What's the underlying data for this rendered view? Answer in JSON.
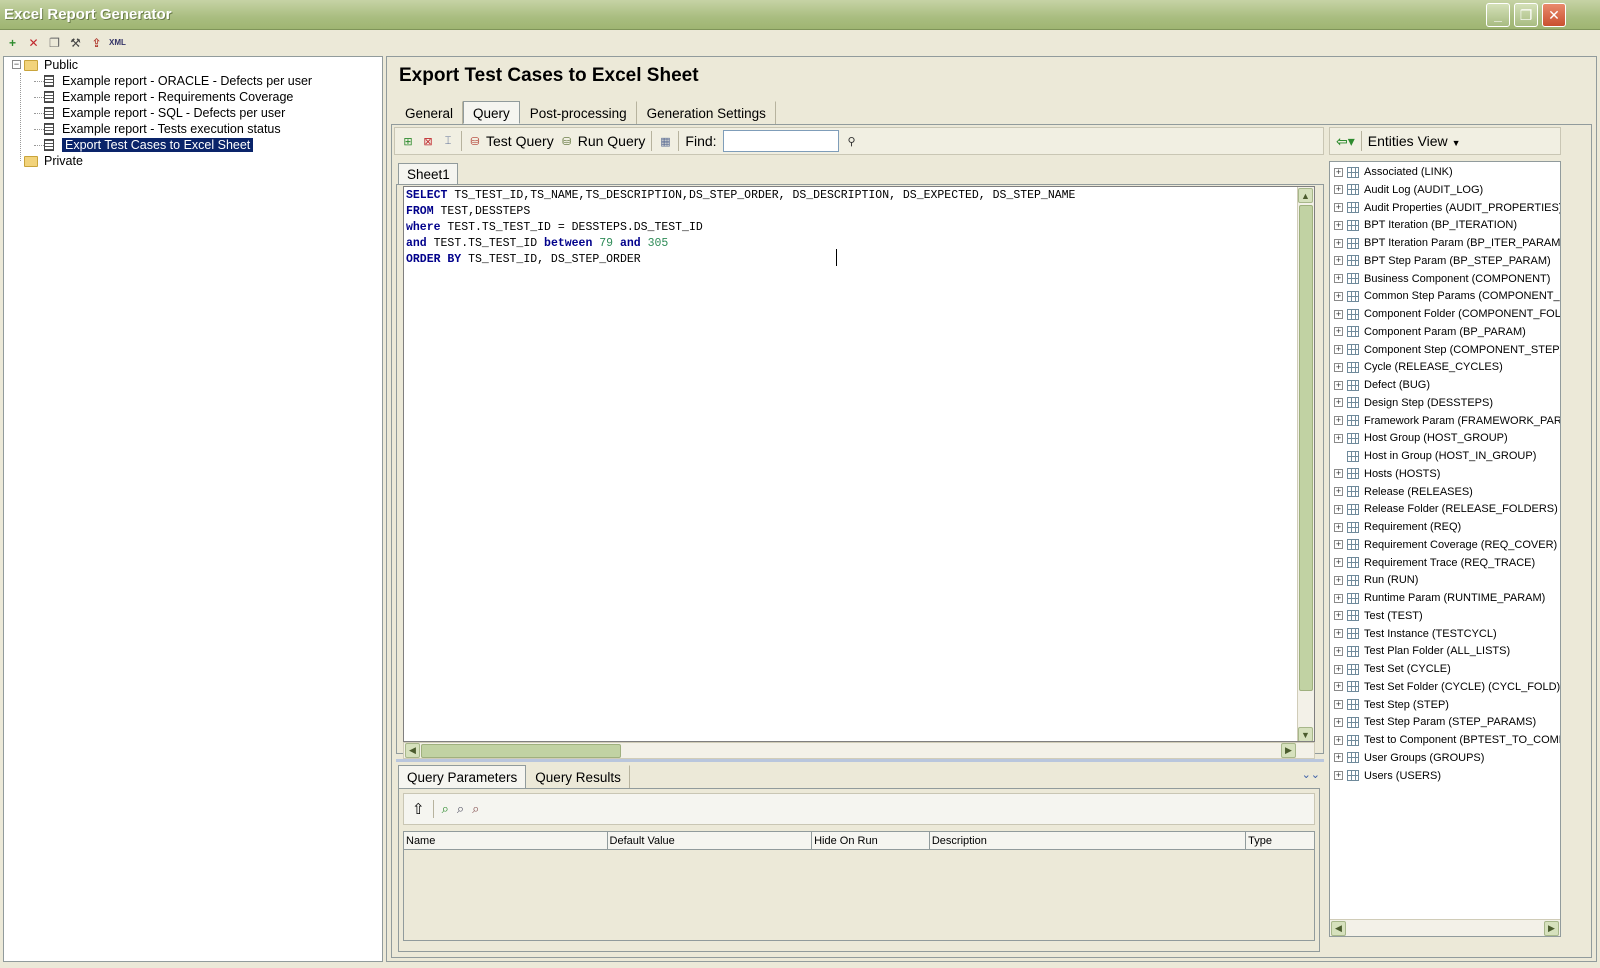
{
  "window": {
    "title": "Excel Report Generator"
  },
  "tree": {
    "public_label": "Public",
    "private_label": "Private",
    "reports": [
      "Example report - ORACLE - Defects per user",
      "Example report - Requirements Coverage",
      "Example report - SQL - Defects per user",
      "Example report - Tests execution status",
      "Export Test Cases to Excel Sheet"
    ]
  },
  "page": {
    "title": "Export Test Cases to Excel Sheet",
    "tabs": [
      "General",
      "Query",
      "Post-processing",
      "Generation Settings"
    ],
    "active_tab": "Query"
  },
  "query_toolbar": {
    "test_query": "Test Query",
    "run_query": "Run Query",
    "find_label": "Find:",
    "find_value": ""
  },
  "sheet": {
    "tab": "Sheet1"
  },
  "sql": {
    "line1_kw": "SELECT",
    "line1_rest": " TS_TEST_ID,TS_NAME,TS_DESCRIPTION,DS_STEP_ORDER, DS_DESCRIPTION, DS_EXPECTED, DS_STEP_NAME",
    "line2_kw": "FROM",
    "line2_rest": " TEST,DESSTEPS",
    "line3_kw": "where",
    "line3_rest": " TEST.TS_TEST_ID = DESSTEPS.DS_TEST_ID",
    "line4_kw1": "and",
    "line4_mid": " TEST.TS_TEST_ID ",
    "line4_kw2": "between",
    "line4_n1": "79",
    "line4_kw3": "and",
    "line4_n2": "305",
    "line5_kw": "ORDER BY",
    "line5_rest": " TS_TEST_ID, DS_STEP_ORDER"
  },
  "bottom": {
    "tabs": [
      "Query Parameters",
      "Query Results"
    ],
    "columns": [
      "Name",
      "Default Value",
      "Hide On Run",
      "Description",
      "Type"
    ]
  },
  "entities": {
    "view_label": "Entities View",
    "items": [
      {
        "label": "Associated (LINK)",
        "expandable": true
      },
      {
        "label": "Audit Log (AUDIT_LOG)",
        "expandable": true
      },
      {
        "label": "Audit Properties (AUDIT_PROPERTIES)",
        "expandable": true
      },
      {
        "label": "BPT Iteration (BP_ITERATION)",
        "expandable": true
      },
      {
        "label": "BPT Iteration Param (BP_ITER_PARAM)",
        "expandable": true
      },
      {
        "label": "BPT Step Param (BP_STEP_PARAM)",
        "expandable": true
      },
      {
        "label": "Business Component (COMPONENT)",
        "expandable": true
      },
      {
        "label": "Common Step Params (COMPONENT_STEP_",
        "expandable": true
      },
      {
        "label": "Component Folder (COMPONENT_FOLDER)",
        "expandable": true
      },
      {
        "label": "Component Param (BP_PARAM)",
        "expandable": true
      },
      {
        "label": "Component Step (COMPONENT_STEP)",
        "expandable": true
      },
      {
        "label": "Cycle (RELEASE_CYCLES)",
        "expandable": true
      },
      {
        "label": "Defect (BUG)",
        "expandable": true
      },
      {
        "label": "Design Step (DESSTEPS)",
        "expandable": true
      },
      {
        "label": "Framework Param (FRAMEWORK_PARAM)",
        "expandable": true
      },
      {
        "label": "Host Group (HOST_GROUP)",
        "expandable": true
      },
      {
        "label": "Host in Group (HOST_IN_GROUP)",
        "expandable": false
      },
      {
        "label": "Hosts (HOSTS)",
        "expandable": true
      },
      {
        "label": "Release (RELEASES)",
        "expandable": true
      },
      {
        "label": "Release Folder (RELEASE_FOLDERS)",
        "expandable": true
      },
      {
        "label": "Requirement (REQ)",
        "expandable": true
      },
      {
        "label": "Requirement Coverage (REQ_COVER)",
        "expandable": true
      },
      {
        "label": "Requirement Trace (REQ_TRACE)",
        "expandable": true
      },
      {
        "label": "Run (RUN)",
        "expandable": true
      },
      {
        "label": "Runtime Param (RUNTIME_PARAM)",
        "expandable": true
      },
      {
        "label": "Test (TEST)",
        "expandable": true
      },
      {
        "label": "Test Instance (TESTCYCL)",
        "expandable": true
      },
      {
        "label": "Test Plan Folder (ALL_LISTS)",
        "expandable": true
      },
      {
        "label": "Test Set (CYCLE)",
        "expandable": true
      },
      {
        "label": "Test Set Folder (CYCLE) (CYCL_FOLD)",
        "expandable": true
      },
      {
        "label": "Test Step (STEP)",
        "expandable": true
      },
      {
        "label": "Test Step Param (STEP_PARAMS)",
        "expandable": true
      },
      {
        "label": "Test to Component (BPTEST_TO_COMPONE",
        "expandable": true
      },
      {
        "label": "User Groups (GROUPS)",
        "expandable": true
      },
      {
        "label": "Users (USERS)",
        "expandable": true
      }
    ]
  }
}
